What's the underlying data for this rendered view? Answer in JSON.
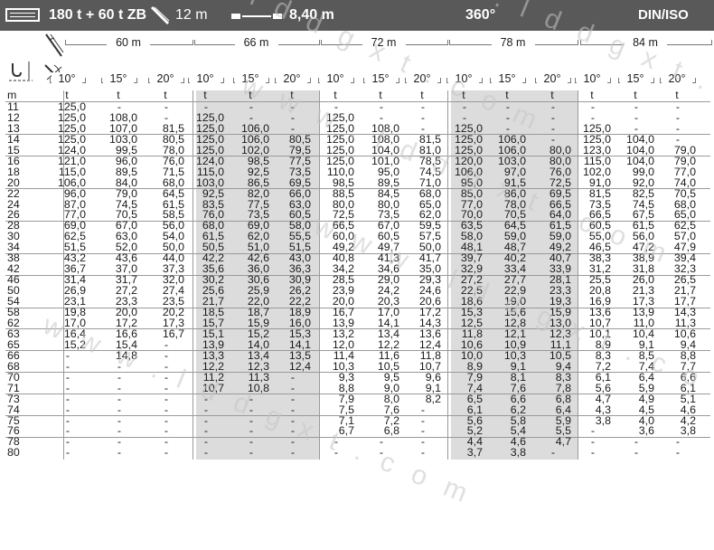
{
  "header": {
    "counterweight": "180 t + 60 t ZB",
    "jib_length": "12 m",
    "outrigger_base": "8,40 m",
    "slewing": "360°",
    "standard": "DIN/ISO"
  },
  "units": {
    "radius": "m",
    "load": "t"
  },
  "boom_lengths": [
    "60 m",
    "66 m",
    "72 m",
    "78 m",
    "84 m"
  ],
  "offset_angles": [
    "10°",
    "15°",
    "20°"
  ],
  "radii": [
    "11",
    "12",
    "13",
    "14",
    "15",
    "16",
    "18",
    "20",
    "22",
    "24",
    "26",
    "28",
    "30",
    "34",
    "38",
    "42",
    "46",
    "50",
    "54",
    "58",
    "62",
    "63",
    "65",
    "66",
    "68",
    "70",
    "71",
    "73",
    "74",
    "75",
    "76",
    "78",
    "80"
  ],
  "rows": [
    [
      "125,0",
      "-",
      "-",
      "-",
      "-",
      "-",
      "-",
      "-",
      "-",
      "-",
      "-",
      "-",
      "-",
      "-",
      "-"
    ],
    [
      "125,0",
      "108,0",
      "-",
      "125,0",
      "-",
      "-",
      "125,0",
      "-",
      "-",
      "-",
      "-",
      "-",
      "-",
      "-",
      "-"
    ],
    [
      "125,0",
      "107,0",
      "81,5",
      "125,0",
      "106,0",
      "-",
      "125,0",
      "108,0",
      "-",
      "125,0",
      "-",
      "-",
      "125,0",
      "-",
      "-"
    ],
    [
      "125,0",
      "103,0",
      "80,5",
      "125,0",
      "106,0",
      "80,5",
      "125,0",
      "108,0",
      "81,5",
      "125,0",
      "106,0",
      "-",
      "125,0",
      "104,0",
      "-"
    ],
    [
      "124,0",
      "99,5",
      "78,0",
      "125,0",
      "102,0",
      "79,5",
      "125,0",
      "104,0",
      "81,0",
      "125,0",
      "106,0",
      "80,0",
      "123,0",
      "104,0",
      "79,0"
    ],
    [
      "121,0",
      "96,0",
      "76,0",
      "124,0",
      "98,5",
      "77,5",
      "125,0",
      "101,0",
      "78,5",
      "120,0",
      "103,0",
      "80,0",
      "115,0",
      "104,0",
      "79,0"
    ],
    [
      "115,0",
      "89,5",
      "71,5",
      "115,0",
      "92,5",
      "73,5",
      "110,0",
      "95,0",
      "74,5",
      "106,0",
      "97,0",
      "76,0",
      "102,0",
      "99,0",
      "77,0"
    ],
    [
      "106,0",
      "84,0",
      "68,0",
      "103,0",
      "86,5",
      "69,5",
      "98,5",
      "89,5",
      "71,0",
      "95,0",
      "91,5",
      "72,5",
      "91,0",
      "92,0",
      "74,0"
    ],
    [
      "96,0",
      "79,0",
      "64,5",
      "92,5",
      "82,0",
      "66,0",
      "88,5",
      "84,5",
      "68,0",
      "85,0",
      "86,0",
      "69,5",
      "81,5",
      "82,5",
      "70,5"
    ],
    [
      "87,0",
      "74,5",
      "61,5",
      "83,5",
      "77,5",
      "63,0",
      "80,0",
      "80,0",
      "65,0",
      "77,0",
      "78,0",
      "66,5",
      "73,5",
      "74,5",
      "68,0"
    ],
    [
      "77,0",
      "70,5",
      "58,5",
      "76,0",
      "73,5",
      "60,5",
      "72,5",
      "73,5",
      "62,0",
      "70,0",
      "70,5",
      "64,0",
      "66,5",
      "67,5",
      "65,0"
    ],
    [
      "69,0",
      "67,0",
      "56,0",
      "68,0",
      "69,0",
      "58,0",
      "66,5",
      "67,0",
      "59,5",
      "63,5",
      "64,5",
      "61,5",
      "60,5",
      "61,5",
      "62,5"
    ],
    [
      "62,5",
      "63,0",
      "54,0",
      "61,5",
      "62,0",
      "55,5",
      "60,0",
      "60,5",
      "57,5",
      "58,0",
      "59,0",
      "59,0",
      "55,0",
      "56,0",
      "57,0"
    ],
    [
      "51,5",
      "52,0",
      "50,0",
      "50,5",
      "51,0",
      "51,5",
      "49,2",
      "49,7",
      "50,0",
      "48,1",
      "48,7",
      "49,2",
      "46,5",
      "47,2",
      "47,9"
    ],
    [
      "43,2",
      "43,6",
      "44,0",
      "42,2",
      "42,6",
      "43,0",
      "40,8",
      "41,3",
      "41,7",
      "39,7",
      "40,2",
      "40,7",
      "38,3",
      "38,9",
      "39,4"
    ],
    [
      "36,7",
      "37,0",
      "37,3",
      "35,6",
      "36,0",
      "36,3",
      "34,2",
      "34,6",
      "35,0",
      "32,9",
      "33,4",
      "33,9",
      "31,2",
      "31,8",
      "32,3"
    ],
    [
      "31,4",
      "31,7",
      "32,0",
      "30,2",
      "30,6",
      "30,9",
      "28,5",
      "29,0",
      "29,3",
      "27,2",
      "27,7",
      "28,1",
      "25,5",
      "26,0",
      "26,5"
    ],
    [
      "26,9",
      "27,2",
      "27,4",
      "25,6",
      "25,9",
      "26,2",
      "23,9",
      "24,2",
      "24,6",
      "22,5",
      "22,9",
      "23,3",
      "20,8",
      "21,3",
      "21,7"
    ],
    [
      "23,1",
      "23,3",
      "23,5",
      "21,7",
      "22,0",
      "22,2",
      "20,0",
      "20,3",
      "20,6",
      "18,6",
      "19,0",
      "19,3",
      "16,9",
      "17,3",
      "17,7"
    ],
    [
      "19,8",
      "20,0",
      "20,2",
      "18,5",
      "18,7",
      "18,9",
      "16,7",
      "17,0",
      "17,2",
      "15,3",
      "15,6",
      "15,9",
      "13,6",
      "13,9",
      "14,3"
    ],
    [
      "17,0",
      "17,2",
      "17,3",
      "15,7",
      "15,9",
      "16,0",
      "13,9",
      "14,1",
      "14,3",
      "12,5",
      "12,8",
      "13,0",
      "10,7",
      "11,0",
      "11,3"
    ],
    [
      "16,4",
      "16,6",
      "16,7",
      "15,1",
      "15,2",
      "15,3",
      "13,2",
      "13,4",
      "13,6",
      "11,8",
      "12,1",
      "12,3",
      "10,1",
      "10,4",
      "10,6"
    ],
    [
      "15,2",
      "15,4",
      "-",
      "13,9",
      "14,0",
      "14,1",
      "12,0",
      "12,2",
      "12,4",
      "10,6",
      "10,9",
      "11,1",
      "8,9",
      "9,1",
      "9,4"
    ],
    [
      "-",
      "14,8",
      "-",
      "13,3",
      "13,4",
      "13,5",
      "11,4",
      "11,6",
      "11,8",
      "10,0",
      "10,3",
      "10,5",
      "8,3",
      "8,5",
      "8,8"
    ],
    [
      "-",
      "-",
      "-",
      "12,2",
      "12,3",
      "12,4",
      "10,3",
      "10,5",
      "10,7",
      "8,9",
      "9,1",
      "9,4",
      "7,2",
      "7,4",
      "7,7"
    ],
    [
      "-",
      "-",
      "-",
      "11,2",
      "11,3",
      "-",
      "9,3",
      "9,5",
      "9,6",
      "7,9",
      "8,1",
      "8,3",
      "6,1",
      "6,4",
      "6,6"
    ],
    [
      "-",
      "-",
      "-",
      "10,7",
      "10,8",
      "-",
      "8,8",
      "9,0",
      "9,1",
      "7,4",
      "7,6",
      "7,8",
      "5,6",
      "5,9",
      "6,1"
    ],
    [
      "-",
      "-",
      "-",
      "-",
      "-",
      "-",
      "7,9",
      "8,0",
      "8,2",
      "6,5",
      "6,6",
      "6,8",
      "4,7",
      "4,9",
      "5,1"
    ],
    [
      "-",
      "-",
      "-",
      "-",
      "-",
      "-",
      "7,5",
      "7,6",
      "-",
      "6,1",
      "6,2",
      "6,4",
      "4,3",
      "4,5",
      "4,6"
    ],
    [
      "-",
      "-",
      "-",
      "-",
      "-",
      "-",
      "7,1",
      "7,2",
      "-",
      "5,6",
      "5,8",
      "5,9",
      "3,8",
      "4,0",
      "4,2"
    ],
    [
      "-",
      "-",
      "-",
      "-",
      "-",
      "-",
      "6,7",
      "6,8",
      "-",
      "5,2",
      "5,4",
      "5,5",
      "-",
      "3,6",
      "3,8"
    ],
    [
      "-",
      "-",
      "-",
      "-",
      "-",
      "-",
      "-",
      "-",
      "-",
      "4,4",
      "4,6",
      "4,7",
      "-",
      "-",
      "-"
    ],
    [
      "-",
      "-",
      "-",
      "-",
      "-",
      "-",
      "-",
      "-",
      "-",
      "3,7",
      "3,8",
      "-",
      "-",
      "-",
      "-"
    ]
  ],
  "watermark": "www.lddgxt.com",
  "colors": {
    "topbar": "#595959",
    "shade": "#dcdcdc",
    "text": "#1a1a1a"
  }
}
